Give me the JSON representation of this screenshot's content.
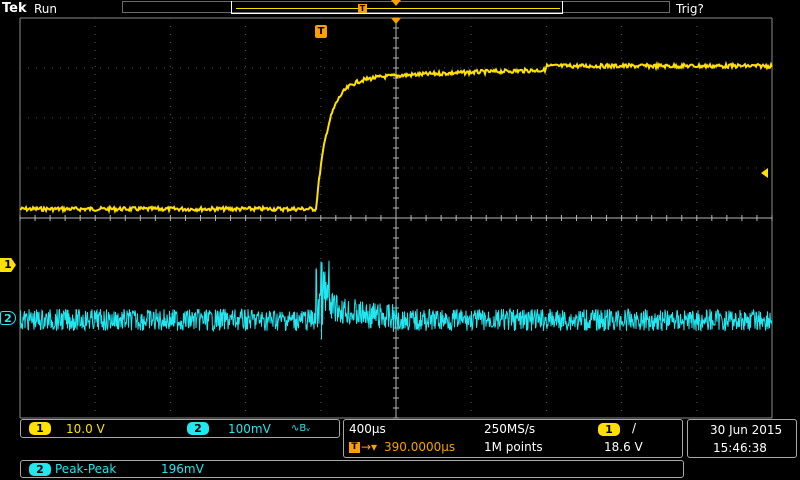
{
  "header": {
    "brand": "Tek",
    "acquisition_state": "Run",
    "trigger_state": "Trig?"
  },
  "markers": {
    "trigger_marker": "T",
    "ch1": "1",
    "ch2": "2"
  },
  "channel_panel": {
    "ch1_number": "1",
    "ch1_scale": "10.0 V",
    "ch2_number": "2",
    "ch2_scale": "100mV",
    "ch2_bandwidth_symbol": "∿Bᵥ"
  },
  "timebase_panel": {
    "time_per_div": "400µs",
    "sample_rate": "250MS/s",
    "trigger_delay": "390.0000µs",
    "record_length": "1M points",
    "trigger_source": "1",
    "trigger_slope": "/",
    "trigger_level": "18.6 V"
  },
  "datetime": {
    "date": "30 Jun  2015",
    "time": "15:46:38"
  },
  "measurement": {
    "channel": "2",
    "type": "Peak-Peak",
    "value": "196mV"
  },
  "colors": {
    "ch1": "#ffe000",
    "ch2": "#22e6f0",
    "trigger": "#ff9e00",
    "grid": "#8a8a8a"
  }
}
